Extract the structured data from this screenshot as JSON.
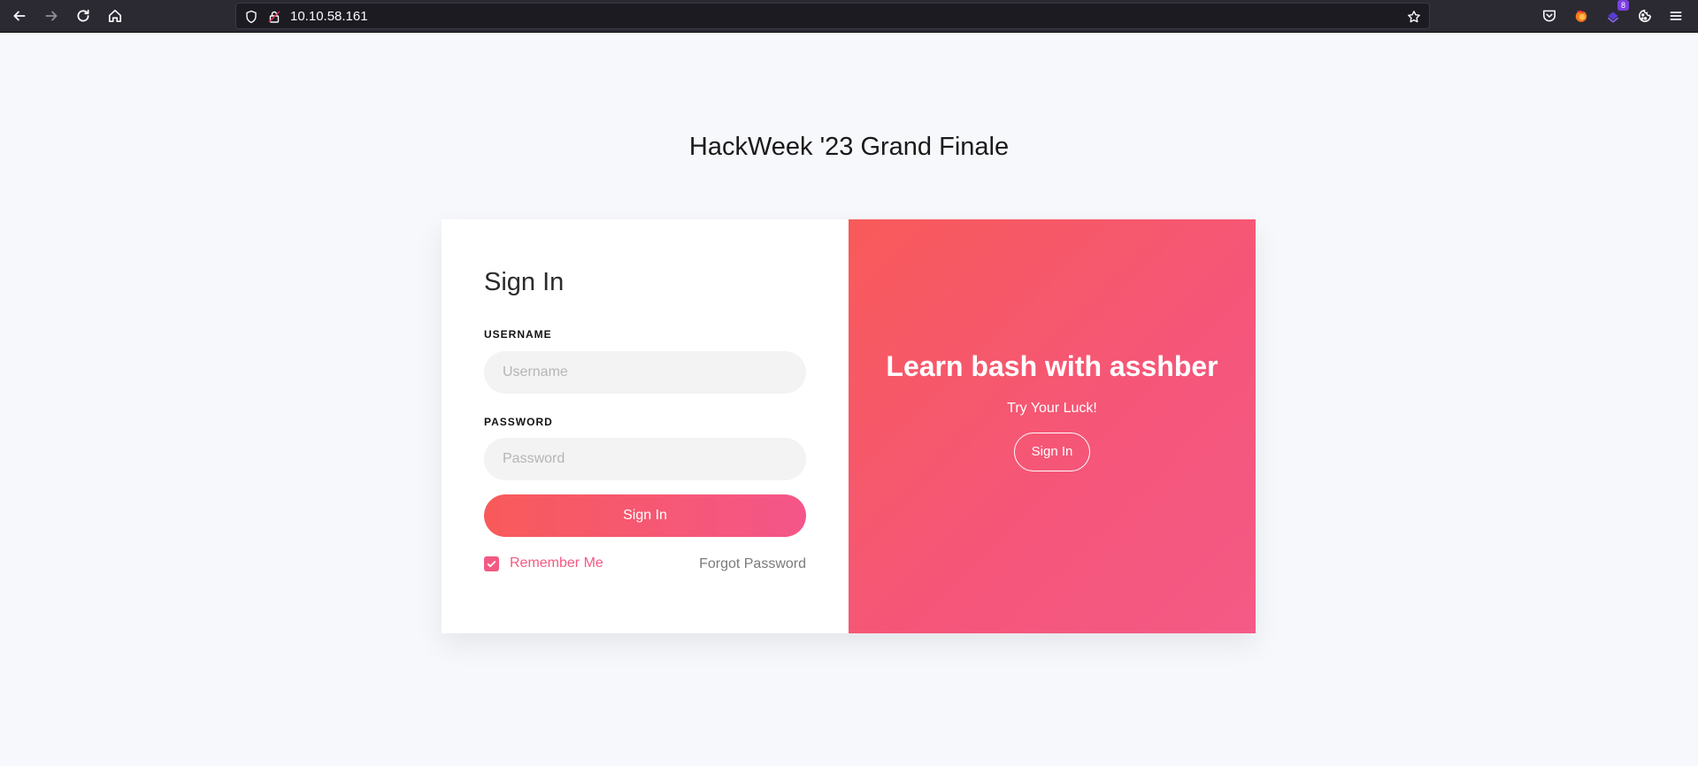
{
  "browser": {
    "url": "10.10.58.161",
    "extension_badge": "8",
    "icons": {
      "back": "back-arrow-icon",
      "forward": "forward-arrow-icon",
      "reload": "reload-icon",
      "home": "home-icon",
      "shield": "tracking-protection-shield-icon",
      "lock": "lock-icon",
      "bookmark": "bookmark-star-icon",
      "pocket": "pocket-icon",
      "menu": "hamburger-menu-icon"
    }
  },
  "page": {
    "title": "HackWeek '23 Grand Finale"
  },
  "signin_form": {
    "heading": "Sign In",
    "username_label": "USERNAME",
    "username_placeholder": "Username",
    "username_value": "",
    "password_label": "PASSWORD",
    "password_placeholder": "Password",
    "password_value": "",
    "submit_label": "Sign In",
    "remember_label": "Remember Me",
    "remember_checked": true,
    "forgot_label": "Forgot Password"
  },
  "promo_panel": {
    "title": "Learn bash with asshber",
    "subtitle": "Try Your Luck!",
    "button_label": "Sign In"
  },
  "colors": {
    "accent": "#f35a83",
    "gradient_start": "#f85a5a",
    "gradient_end": "#f4568a",
    "page_background": "#f7f8fc",
    "toolbar": "#2b2a33"
  }
}
